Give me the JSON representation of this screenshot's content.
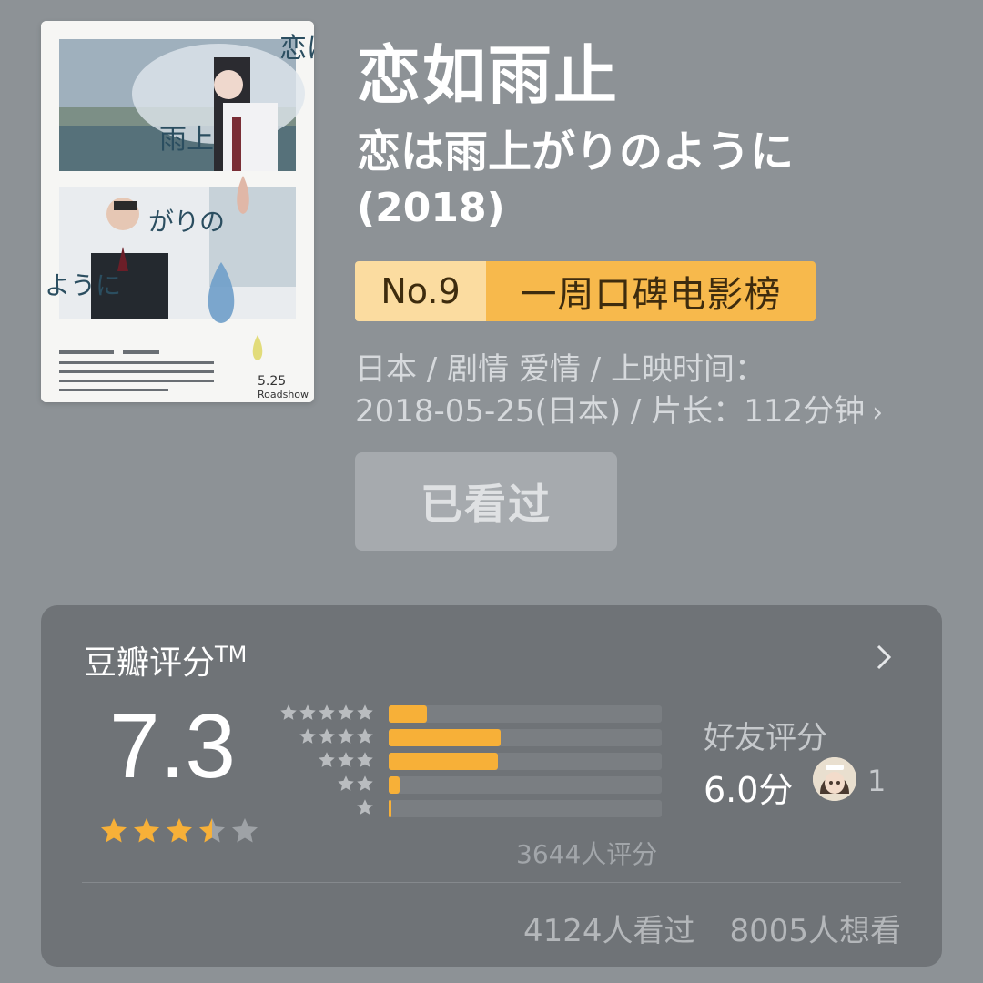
{
  "movie": {
    "title": "恋如雨止",
    "original_title": "恋は雨上がりのように",
    "year": "(2018)",
    "poster": {
      "vertical_title": [
        "恋は",
        "雨上",
        "がりの",
        "ように"
      ],
      "release": "5.25",
      "roadshow": "Roadshow"
    }
  },
  "rank": {
    "number": "No.9",
    "list_name": "一周口碑电影榜"
  },
  "meta": {
    "line1": "日本 / 剧情 爱情 / 上映时间：",
    "line2": "2018-05-25(日本) / 片长：112分钟",
    "chevron": "›"
  },
  "actions": {
    "watched_label": "已看过"
  },
  "rating": {
    "title": "豆瓣评分",
    "tm": "TM",
    "score": "7.3",
    "stars": 3.5,
    "distribution": [
      {
        "stars": 5,
        "fraction": 0.14
      },
      {
        "stars": 4,
        "fraction": 0.41
      },
      {
        "stars": 3,
        "fraction": 0.4
      },
      {
        "stars": 2,
        "fraction": 0.04
      },
      {
        "stars": 1,
        "fraction": 0.01
      }
    ],
    "count_text": "3644人评分",
    "friends": {
      "label": "好友评分",
      "score": "6.0分",
      "count": "1"
    },
    "watched_text": "4124人看过",
    "want_text": "8005人想看"
  },
  "colors": {
    "background": "#8d9296",
    "card": "#6f7377",
    "accent_orange": "#f7b038",
    "rank_light": "#fbdca0",
    "rank_dark": "#f7b94c"
  }
}
